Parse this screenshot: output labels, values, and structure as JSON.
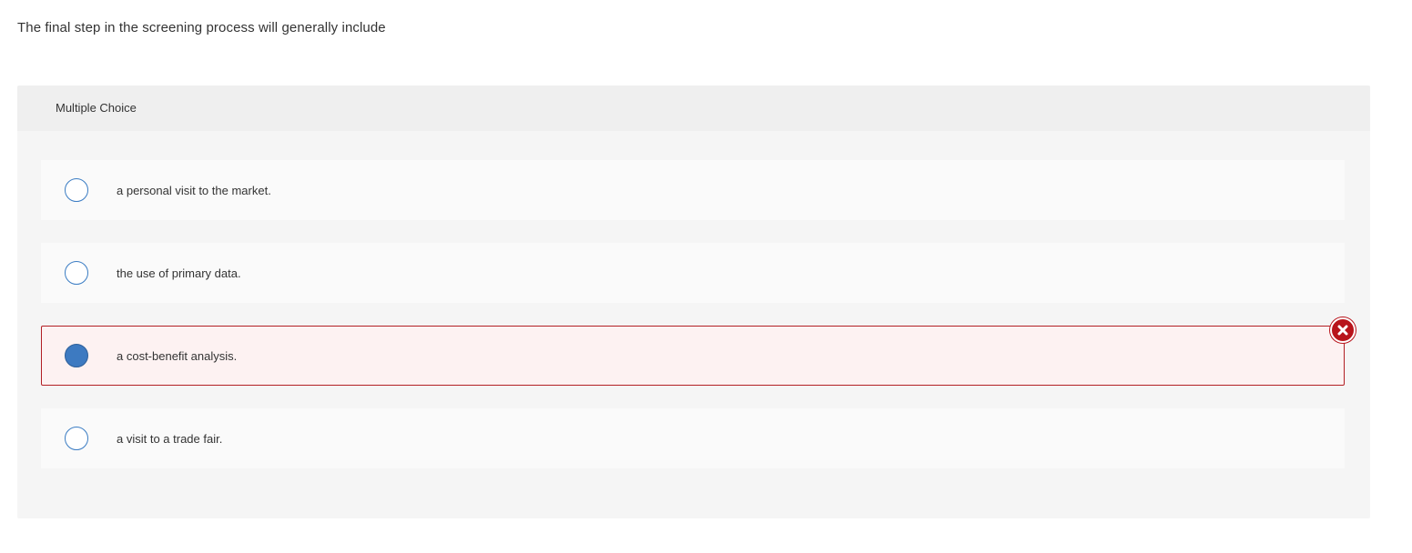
{
  "question": {
    "text": "The final step in the screening process will generally include"
  },
  "panel": {
    "header_label": "Multiple Choice"
  },
  "options": [
    {
      "label": "a personal visit to the market.",
      "selected": false,
      "status": ""
    },
    {
      "label": "the use of primary data.",
      "selected": false,
      "status": ""
    },
    {
      "label": "a cost-benefit analysis.",
      "selected": true,
      "status": "incorrect"
    },
    {
      "label": "a visit to a trade fair.",
      "selected": false,
      "status": ""
    }
  ],
  "icons": {
    "incorrect_marker": "x-circle-icon"
  },
  "colors": {
    "radio_border": "#3a7cc3",
    "radio_selected": "#3d7ac1",
    "incorrect_border": "#b21f24",
    "incorrect_background": "#fdf2f2",
    "incorrect_icon": "#b8141b"
  }
}
